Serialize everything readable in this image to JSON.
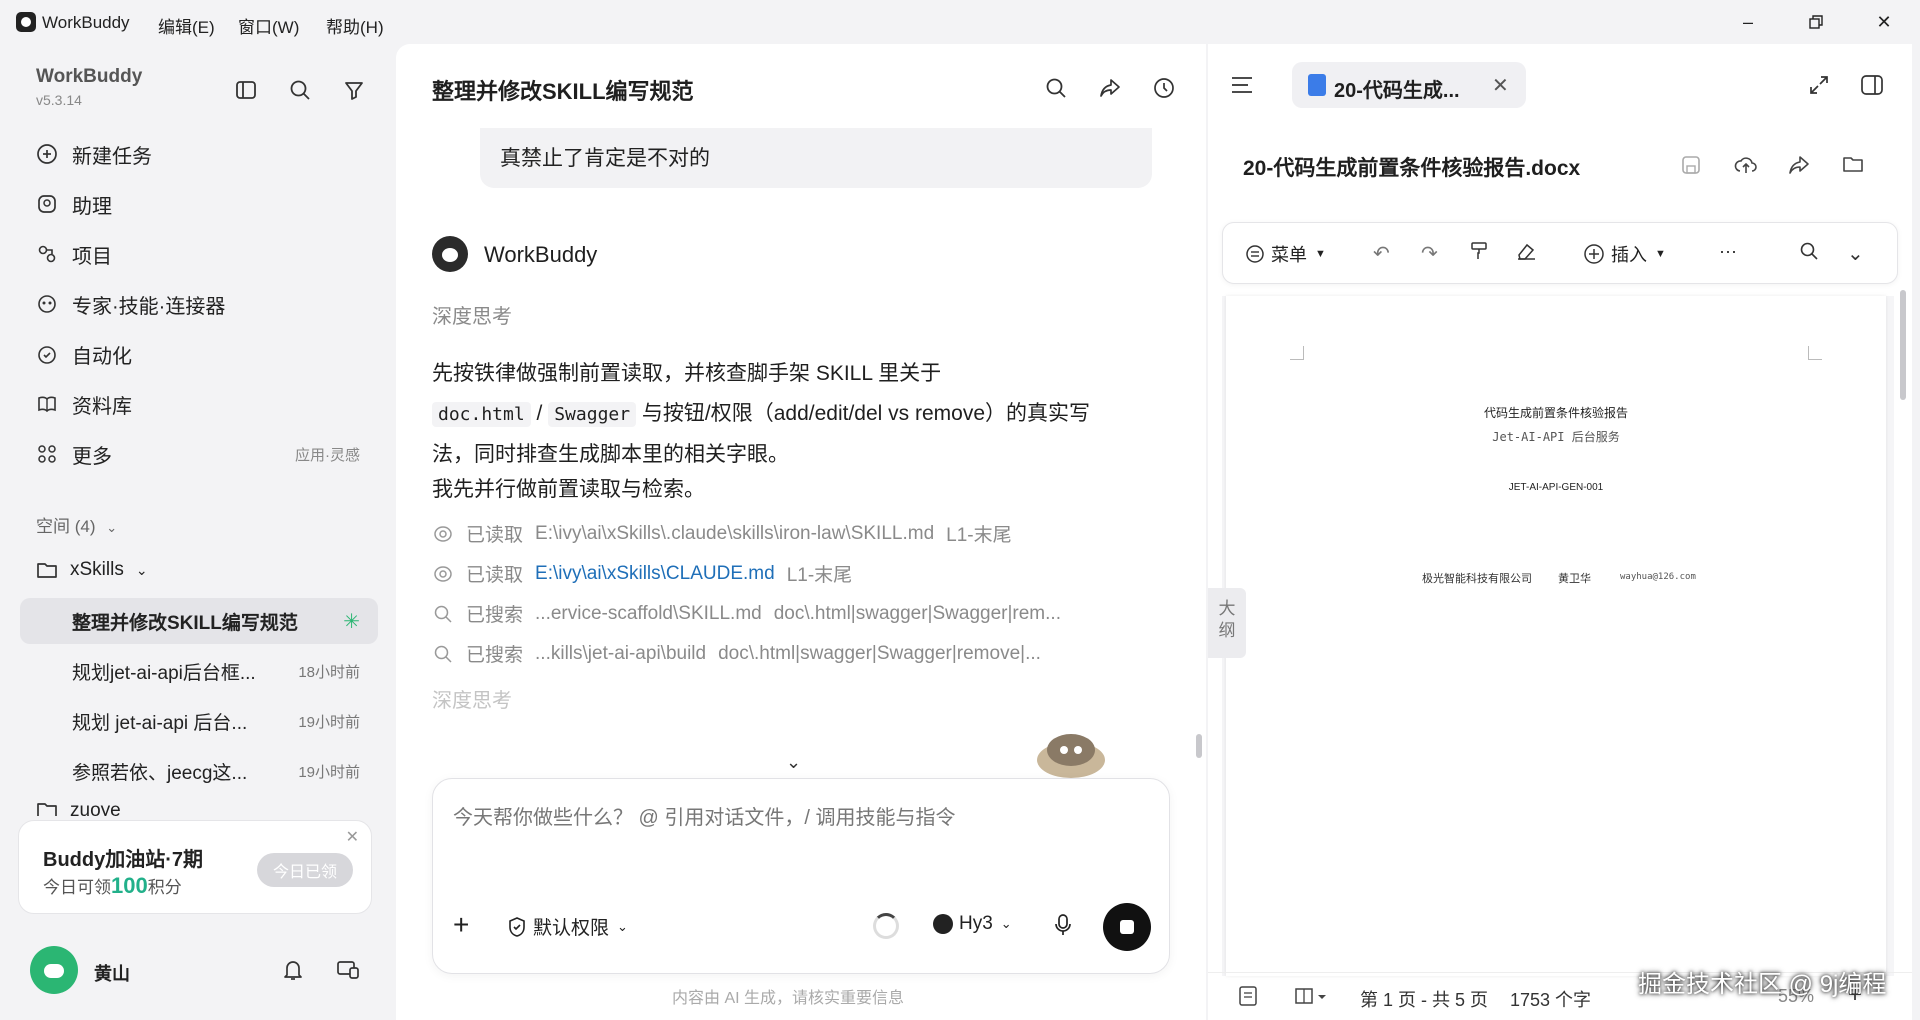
{
  "titlebar": {
    "app_name": "WorkBuddy",
    "menus": [
      "编辑(E)",
      "窗口(W)",
      "帮助(H)"
    ]
  },
  "sidebar": {
    "title": "WorkBuddy",
    "version": "v5.3.14",
    "nav": [
      {
        "label": "新建任务",
        "icon": "new-task-icon"
      },
      {
        "label": "助理",
        "icon": "assistant-icon"
      },
      {
        "label": "项目",
        "icon": "project-icon"
      },
      {
        "label": "专家·技能·连接器",
        "icon": "expert-icon"
      },
      {
        "label": "自动化",
        "icon": "automation-icon"
      },
      {
        "label": "资料库",
        "icon": "library-icon"
      },
      {
        "label": "更多",
        "icon": "more-icon",
        "extra": "应用·灵感"
      }
    ],
    "spaces_label": "空间 (4)",
    "project": "xSkills",
    "tasks": [
      {
        "label": "整理并修改SKILL编写规范",
        "time": ""
      },
      {
        "label": "规划jet-ai-api后台框...",
        "time": "18小时前"
      },
      {
        "label": "规划 jet-ai-api 后台...",
        "time": "19小时前"
      },
      {
        "label": "参照若依、jeecg这...",
        "time": "19小时前"
      }
    ],
    "next_project": "zuoye",
    "promo": {
      "title": "Buddy加油站·7期",
      "line_prefix": "今日可领",
      "points": "100",
      "line_suffix": "积分",
      "button": "今日已领"
    },
    "user_name": "黄山"
  },
  "chat": {
    "title": "整理并修改SKILL编写规范",
    "user_message": "真禁止了肯定是不对的",
    "bot_name": "WorkBuddy",
    "thinking_label": "深度思考",
    "para1_a": "先按铁律做强制前置读取，并核查脚手架 SKILL 里关于",
    "para1_code1": "doc.html",
    "para1_sep": " / ",
    "para1_code2": "Swagger",
    "para1_b": " 与按钮/权限（add/edit/del vs remove）的真实写",
    "para1_c": "法，同时排查生成脚本里的相关字眼。",
    "para2": "我先并行做前置读取与检索。",
    "logs": [
      {
        "action": "已读取",
        "path": "E:\\ivy\\ai\\xSkills\\.claude\\skills\\iron-law\\SKILL.md",
        "range": "L1-末尾",
        "link": false,
        "icon": "eye-icon"
      },
      {
        "action": "已读取",
        "path": "E:\\ivy\\ai\\xSkills\\CLAUDE.md",
        "range": "L1-末尾",
        "link": true,
        "icon": "eye-icon"
      },
      {
        "action": "已搜索",
        "path": "...ervice-scaffold\\SKILL.md",
        "range": "doc\\.html|swagger|Swagger|rem...",
        "link": false,
        "icon": "search-icon"
      },
      {
        "action": "已搜索",
        "path": "...kills\\jet-ai-api\\build",
        "range": "doc\\.html|swagger|Swagger|remove|...",
        "link": false,
        "icon": "search-icon"
      }
    ],
    "thinking_label2": "深度思考",
    "composer_placeholder": "今天帮你做些什么？ @ 引用对话文件，/ 调用技能与指令",
    "permission": "默认权限",
    "model": "Hy3",
    "footnote": "内容由 AI 生成，请核实重要信息"
  },
  "doc": {
    "tab_name": "20-代码生成...",
    "file_name": "20-代码生成前置条件核验报告.docx",
    "toolbar": {
      "menu": "菜单",
      "insert": "插入",
      "more": "···"
    },
    "page": {
      "title": "代码生成前置条件核验报告",
      "subtitle": "Jet-AI-API 后台服务",
      "code": "JET-AI-API-GEN-001",
      "company": "极光智能科技有限公司",
      "author": "黄卫华",
      "email": "wayhua@126.com"
    },
    "outline": "大纲",
    "status": {
      "page": "第 1 页 - 共 5 页",
      "words": "1753 个字",
      "zoom": "55%"
    }
  },
  "watermark": "掘金技术社区 @ 9j编程"
}
